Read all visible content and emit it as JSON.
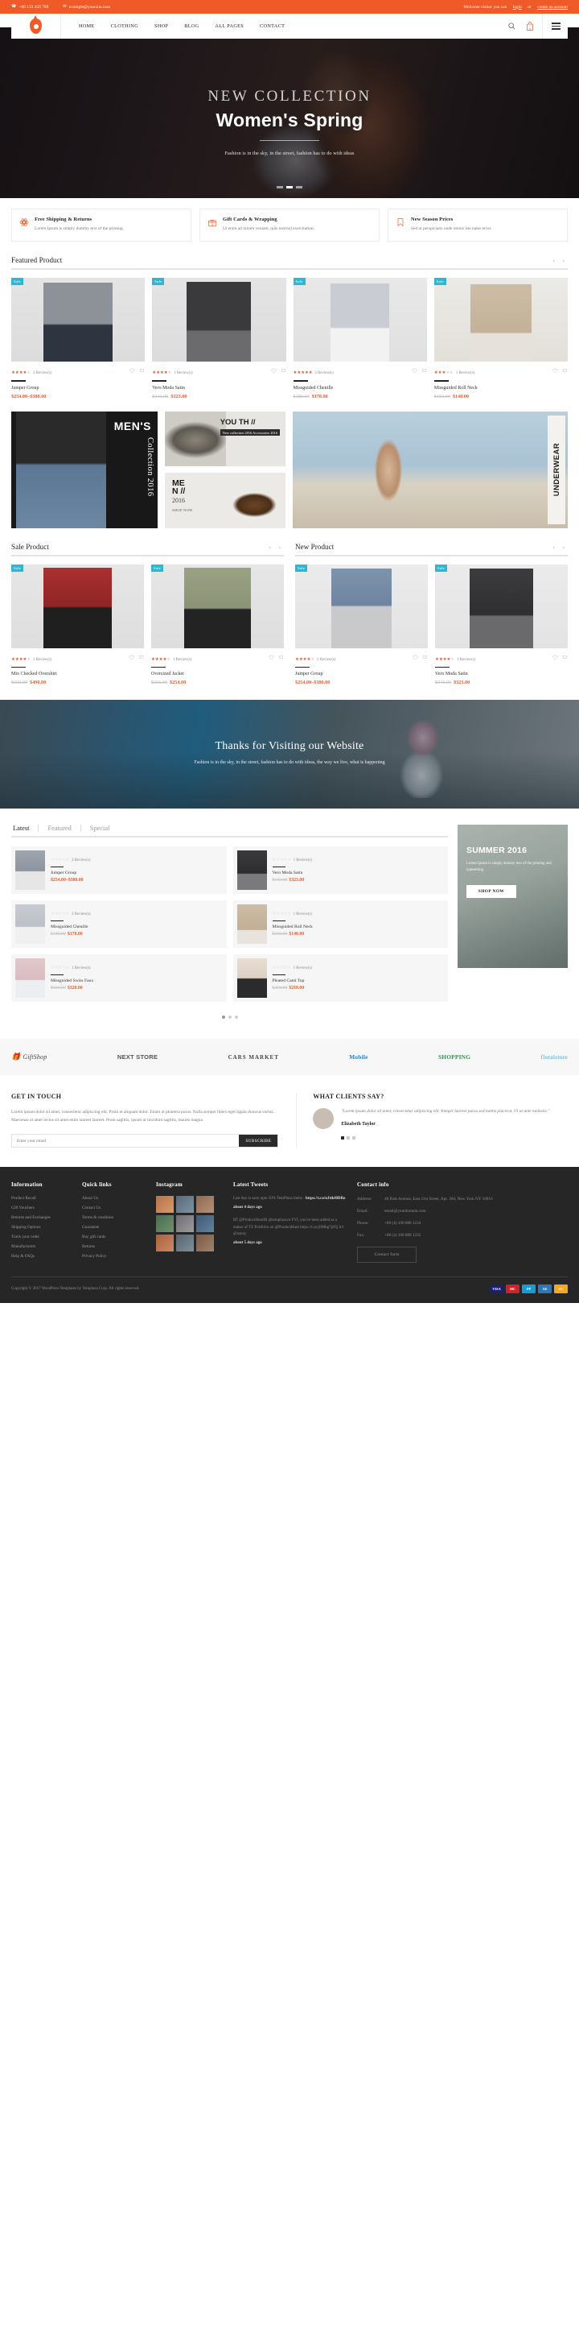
{
  "topbar": {
    "phone": "+00 123 456 789",
    "phone_icon": "phone-icon",
    "email": "example@yoursite.com",
    "email_icon": "envelope-icon",
    "welcome_prefix": "Welcome visitor you can",
    "login_label": "login",
    "or_label": "or",
    "create_label": "create an account"
  },
  "header": {
    "logo_name": "site-logo",
    "nav": [
      {
        "label": "HOME"
      },
      {
        "label": "CLOTHING"
      },
      {
        "label": "SHOP"
      },
      {
        "label": "BLOG"
      },
      {
        "label": "ALL PAGES"
      },
      {
        "label": "CONTACT"
      }
    ],
    "search_icon": "search-icon",
    "cart_icon": "shopping-bag-icon",
    "cart_count": "0",
    "menu_icon": "hamburger-menu-icon"
  },
  "hero": {
    "eyebrow": "NEW COLLECTION",
    "title": "Women's Spring",
    "description": "Fashion is in the sky, in the street, fashion has to do with ideas",
    "dots": 3,
    "active_dot": 1
  },
  "features": [
    {
      "icon": "atom-icon",
      "title": "Free Shipping & Returns",
      "text": "Lorem Ipsum is simply dummy text of the printing."
    },
    {
      "icon": "gift-icon",
      "title": "Gift Cards & Wrapping",
      "text": "Ut enim ad minim veniam, quis nostrud exercitation."
    },
    {
      "icon": "bookmark-icon",
      "title": "New Season Prices",
      "text": "Sed ut perspiciatis unde omnis iste natus error."
    }
  ],
  "featured": {
    "title": "Featured Product",
    "prev_icon": "chevron-left-icon",
    "next_icon": "chevron-right-icon",
    "products": [
      {
        "badge": "Sale",
        "stars": 4,
        "reviews": "2 Review(s)",
        "name": "Jumper Group",
        "price": "$254.00–$380.00",
        "old_price": ""
      },
      {
        "badge": "Sale",
        "stars": 4,
        "reviews": "1 Review(s)",
        "name": "Vero Moda Satin",
        "price": "$323.00",
        "old_price": "$343.00"
      },
      {
        "badge": "Sale",
        "stars": 5,
        "reviews": "2 Review(s)",
        "name": "Missguided Chenille",
        "price": "$178.00",
        "old_price": "$180.00"
      },
      {
        "badge": "Sale",
        "stars": 3,
        "reviews": "1 Review(s)",
        "name": "Missguided Roll Neck",
        "price": "$140.00",
        "old_price": "$150.00"
      }
    ]
  },
  "promos": {
    "left": {
      "line1": "MEN'S",
      "vertical": "Collection 2016"
    },
    "youth": {
      "line1": "YOU TH //",
      "tag": "New collection 2016 Accessories 2016"
    },
    "men": {
      "l1": "ME",
      "l2": "N //",
      "l3": "2016",
      "cta": "SHOP NOW"
    },
    "right": {
      "vertical": "UNDERWEAR"
    }
  },
  "sale": {
    "title": "Sale Product",
    "prev_icon": "chevron-left-icon",
    "next_icon": "chevron-right-icon",
    "products": [
      {
        "badge": "Sale",
        "stars": 4,
        "reviews": "1 Review(s)",
        "name": "Mix Checked Overshirt",
        "price": "$490.00",
        "old_price": "$600.00"
      },
      {
        "badge": "Sale",
        "stars": 4,
        "reviews": "1 Review(s)",
        "name": "Oversized Jacket",
        "price": "$254.00",
        "old_price": "$256.00"
      }
    ]
  },
  "newproduct": {
    "title": "New Product",
    "prev_icon": "chevron-left-icon",
    "next_icon": "chevron-right-icon",
    "products": [
      {
        "badge": "Sale",
        "stars": 4,
        "reviews": "2 Review(s)",
        "name": "Jumper Group",
        "price": "$254.00–$380.00",
        "old_price": ""
      },
      {
        "badge": "Sale",
        "stars": 4,
        "reviews": "1 Review(s)",
        "name": "Vero Moda Satin",
        "price": "$323.00",
        "old_price": "$343.00"
      }
    ]
  },
  "parallax": {
    "title": "Thanks for Visiting our Website",
    "text": "Fashion is in the sky, in the street, fashion has to do with ideas, the way we live, what is happening"
  },
  "tabs": {
    "items": [
      {
        "label": "Latest",
        "active": true
      },
      {
        "label": "Featured",
        "active": false
      },
      {
        "label": "Special",
        "active": false
      }
    ],
    "products": [
      {
        "reviews": "2 Review(s)",
        "name": "Jumper Group",
        "price": "$254.00–$380.00",
        "old_price": ""
      },
      {
        "reviews": "1 Review(s)",
        "name": "Vero Moda Satin",
        "price": "$323.00",
        "old_price": "$343.00"
      },
      {
        "reviews": "2 Review(s)",
        "name": "Missguided Chenille",
        "price": "$178.00",
        "old_price": "$180.00"
      },
      {
        "reviews": "1 Review(s)",
        "name": "Missguided Roll Neck",
        "price": "$140.00",
        "old_price": "$150.00"
      },
      {
        "reviews": "1 Review(s)",
        "name": "Missguided Swiss Faux",
        "price": "$320.00",
        "old_price": "$360.00"
      },
      {
        "reviews": "1 Review(s)",
        "name": "Pleated Cami Top",
        "price": "$210.00",
        "old_price": "$250.00"
      }
    ],
    "dots": 3,
    "active_dot": 0
  },
  "sidebanner": {
    "title": "SUMMER 2016",
    "text": "Lorem Ipsum is simply dummy text of the printing and typesetting",
    "cta": "SHOP NOW"
  },
  "brands": [
    {
      "name": "GiftShop",
      "icon": "gift-icon"
    },
    {
      "name": "NEXT STORE",
      "icon": ""
    },
    {
      "name": "CARS MARKET",
      "icon": ""
    },
    {
      "name": "Mobile",
      "icon": ""
    },
    {
      "name": "SHOPPING",
      "icon": ""
    },
    {
      "name": "floralstore",
      "icon": ""
    }
  ],
  "touch": {
    "title": "GET IN TOUCH",
    "text": "Lorem ipsum dolor sit amet, consectetur adipiscing elit. Proin et aliquam dolor. Etiam ut pharetra purus. Nulla semper libero eget ligula rhoncus varius. Maecenas ut amet lectus sit amet enim laoreet laoreet. Proin sagittis, ipsum ut tincidunt sagittis, mauris magna",
    "placeholder": "Enter your email",
    "subscribe_label": "SUBSCRIBE"
  },
  "clients": {
    "title": "WHAT CLIENTS SAY?",
    "quote": "\"Lorem ipsum dolor sit amet, consectetur adipiscing elit. Integer laoreet purus sed mattis placerat. Ut at ante molestie.\"",
    "name": "Elizabeth Taylor",
    "dots": 3,
    "active_dot": 0
  },
  "footer": {
    "information": {
      "title": "Information",
      "items": [
        "Product Recall",
        "Gift Vouchers",
        "Returns and Exchanges",
        "Shipping Options",
        "Track your order",
        "Manufacturers",
        "Help & FAQs"
      ]
    },
    "quick_links": {
      "title": "Quick links",
      "items": [
        "About Us",
        "Contact Us",
        "Terms & condition",
        "Guarantee",
        "Buy gift cards",
        "Returns",
        "Privacy Policy"
      ]
    },
    "instagram": {
      "title": "Instagram",
      "count": 9
    },
    "tweets": {
      "title": "Latest Tweets",
      "items": [
        {
          "text": "Last day to save upto 50% TemPlaza items - ",
          "link": "https://t.co/nJttkf0DRo",
          "ago": "about 4 days ago"
        },
        {
          "text": "RT @ProductHuntHi @templazavn FYI, you've been added as a maker of TZ Portfolio on @ProductHunt https://t.co/j9Mbg7p95j h/t @sonny",
          "link": "",
          "ago": "about 5 days ago"
        }
      ]
    },
    "contact": {
      "title": "Contact info",
      "rows": [
        {
          "key": "Address:",
          "value": "48 Park Avenue, East 21st Street, Apt. 304, New York NY 10016"
        },
        {
          "key": "Email:",
          "value": "email@yourdomain.com"
        },
        {
          "key": "Phone:",
          "value": "+88 (4) 100 888 1234"
        },
        {
          "key": "Fax:",
          "value": "+88 (4) 100 888 1235"
        }
      ],
      "form_label": "Contact form"
    },
    "copyright": "Copyright © 2017 WordPress Templates by Templaza Corp. All rights reserved.",
    "payments": [
      "VISA",
      "MC",
      "PP",
      "AE",
      "DC"
    ]
  },
  "colors": {
    "accent": "#f05a28",
    "badge": "#2cb7d4",
    "footer_bg": "#262626"
  }
}
